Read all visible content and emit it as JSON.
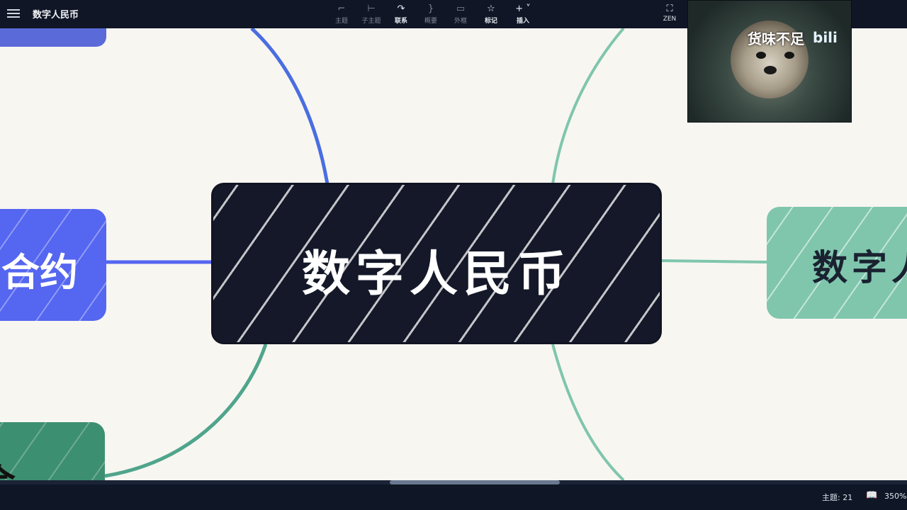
{
  "document_title": "数字人民币",
  "toolbar": {
    "items": [
      {
        "icon": "topic-icon",
        "label": "主题",
        "active": false
      },
      {
        "icon": "subtopic-icon",
        "label": "子主题",
        "active": false
      },
      {
        "icon": "relationship-icon",
        "label": "联系",
        "active": true
      },
      {
        "icon": "summary-icon",
        "label": "概要",
        "active": false
      },
      {
        "icon": "boundary-icon",
        "label": "外框",
        "active": false
      },
      {
        "icon": "star-icon",
        "label": "标记",
        "active": true
      },
      {
        "icon": "plus-icon",
        "label": "插入",
        "active": true
      }
    ],
    "zen_label": "ZEN"
  },
  "mindmap": {
    "center_topic": "数字人民币",
    "left_topic_partial": "合约",
    "left_bottom_topic_partial": "合",
    "right_topic_partial": "数字人"
  },
  "webcam": {
    "caption": "货味不足",
    "logo": "bili"
  },
  "status": {
    "topic_count": "主题: 21",
    "zoom": "350%"
  },
  "colors": {
    "toolbar_bg": "#101625",
    "canvas_bg": "#f8f6f1",
    "center_node": "#141828",
    "blue_branch": "#5566f0",
    "green_branch": "#7fc6ad",
    "dark_green_branch": "#3d8f72"
  }
}
